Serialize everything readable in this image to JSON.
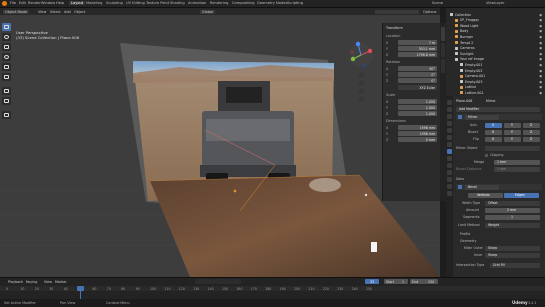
{
  "top_menu": {
    "items": [
      "File",
      "Edit",
      "Render",
      "Window",
      "Help"
    ],
    "workspaces": [
      "Layout",
      "Modeling",
      "Sculpting",
      "UV Editing",
      "Texture Paint",
      "Shading",
      "Animation",
      "Rendering",
      "Compositing",
      "Geometry Nodes",
      "Scripting"
    ],
    "active_workspace": "Layout",
    "scene_label": "Scene",
    "view_layer_label": "ViewLayer"
  },
  "viewport_header": {
    "mode": "Object Mode",
    "menus": [
      "View",
      "Select",
      "Add",
      "Object"
    ],
    "orientation": "Global",
    "options": "Options"
  },
  "viewport": {
    "overlay_title": "User Perspective",
    "overlay_subtitle": "(33) Scene Collection | Plane.006"
  },
  "n_panel": {
    "tabs": [
      "Item",
      "Tool",
      "View"
    ],
    "transform_title": "Transform",
    "location_label": "Location",
    "location": [
      [
        "X",
        "7 m"
      ],
      [
        "Y",
        "303.1 mm"
      ],
      [
        "Z",
        "1796.8 mm"
      ]
    ],
    "rotation_label": "Rotation",
    "rotation": [
      [
        "X",
        "90°"
      ],
      [
        "Y",
        "0°"
      ],
      [
        "Z",
        "0°"
      ]
    ],
    "mode_label": "XYZ Euler",
    "scale_label": "Scale",
    "scale": [
      [
        "X",
        "1.000"
      ],
      [
        "Y",
        "1.000"
      ],
      [
        "Z",
        "1.000"
      ]
    ],
    "dimensions_label": "Dimensions",
    "dimensions": [
      [
        "X",
        "1998 mm"
      ],
      [
        "Y",
        "1998 mm"
      ],
      [
        "Z",
        "0 mm"
      ]
    ]
  },
  "outliner": {
    "rows": [
      {
        "name": "Collection",
        "indent": 0,
        "color": "#c8c8c8"
      },
      {
        "name": "SP_Ymggay",
        "indent": 1,
        "color": "#e0a050"
      },
      {
        "name": "Wood Light",
        "indent": 1,
        "color": "#e0a050"
      },
      {
        "name": "Body",
        "indent": 1,
        "color": "#e0a050"
      },
      {
        "name": "Bumper",
        "indent": 1,
        "color": "#e0a050"
      },
      {
        "name": "Tempt 2",
        "indent": 1,
        "color": "#e0a050"
      },
      {
        "name": "Cameras",
        "indent": 1,
        "color": "#c8c8c8"
      },
      {
        "name": "Sunlight",
        "indent": 1,
        "color": "#c8c8c8"
      },
      {
        "name": "Your ref image",
        "indent": 1,
        "color": "#c8c8c8"
      },
      {
        "name": "Empty.001",
        "indent": 2,
        "color": "#c8c8c8"
      },
      {
        "name": "Empty.002",
        "indent": 2,
        "color": "#c8c8c8"
      },
      {
        "name": "Camera.001",
        "indent": 2,
        "color": "#e0a050"
      },
      {
        "name": "Empty.003",
        "indent": 2,
        "color": "#c8c8c8"
      },
      {
        "name": "Lattice",
        "indent": 2,
        "color": "#e0a050"
      },
      {
        "name": "Lattice.001",
        "indent": 2,
        "color": "#e0a050"
      }
    ]
  },
  "properties": {
    "object_name": "Plane.006",
    "modifier_tab": "Mirror",
    "add_modifier": "Add Modifier",
    "mirror_name": "Mirror",
    "axis_label": "Axis",
    "bisect_label": "Bisect",
    "flip_label": "Flip",
    "axis_values": [
      "X",
      "Y",
      "Z"
    ],
    "mirror_object_label": "Mirror Object",
    "clipping_label": "Clipping",
    "merge_label": "Merge",
    "merge_value": "1 mm",
    "bisect_distance_label": "Bisect Distance",
    "bisect_distance_value": "1 mm",
    "data_label": "Data",
    "bevel_name": "Bevel",
    "bevel_tabs": [
      "Vertices",
      "Edges"
    ],
    "width_type_label": "Width Type",
    "width_type_value": "Offset",
    "amount_label": "Amount",
    "amount_value": "2 mm",
    "segments_label": "Segments",
    "segments_value": "1",
    "limit_method_label": "Limit Method",
    "limit_method_value": "Weight",
    "profile_label": "Profile",
    "geometry_label": "Geometry",
    "miter_outer_label": "Miter Outer",
    "miter_outer_value": "Sharp",
    "inner_label": "Inner",
    "inner_value": "Sharp",
    "intersection_label": "Intersection Type",
    "intersection_value": "Grid Fill"
  },
  "timeline": {
    "menus": [
      "Playback",
      "Keying",
      "View",
      "Marker"
    ],
    "current_frame": "33",
    "start_label": "Start",
    "start_value": "1",
    "end_label": "End",
    "end_value": "250",
    "ruler": [
      "0",
      "10",
      "20",
      "30",
      "40",
      "50",
      "60",
      "70",
      "80",
      "90",
      "100",
      "110",
      "120",
      "130",
      "140",
      "150",
      "160",
      "170",
      "180",
      "190",
      "200",
      "210",
      "220",
      "230",
      "240",
      "250"
    ]
  },
  "status_bar": {
    "items": [
      "Set Active Modifier",
      "Pan View",
      "Context Menu"
    ],
    "watermark": "Udemy",
    "version": "3.4.1"
  },
  "colors": {
    "accent_blue": "#4772b3",
    "active_orange": "#e0a050",
    "axis_x": "#e04a5a",
    "axis_y": "#7fbf3f",
    "axis_z": "#4a8aff"
  }
}
